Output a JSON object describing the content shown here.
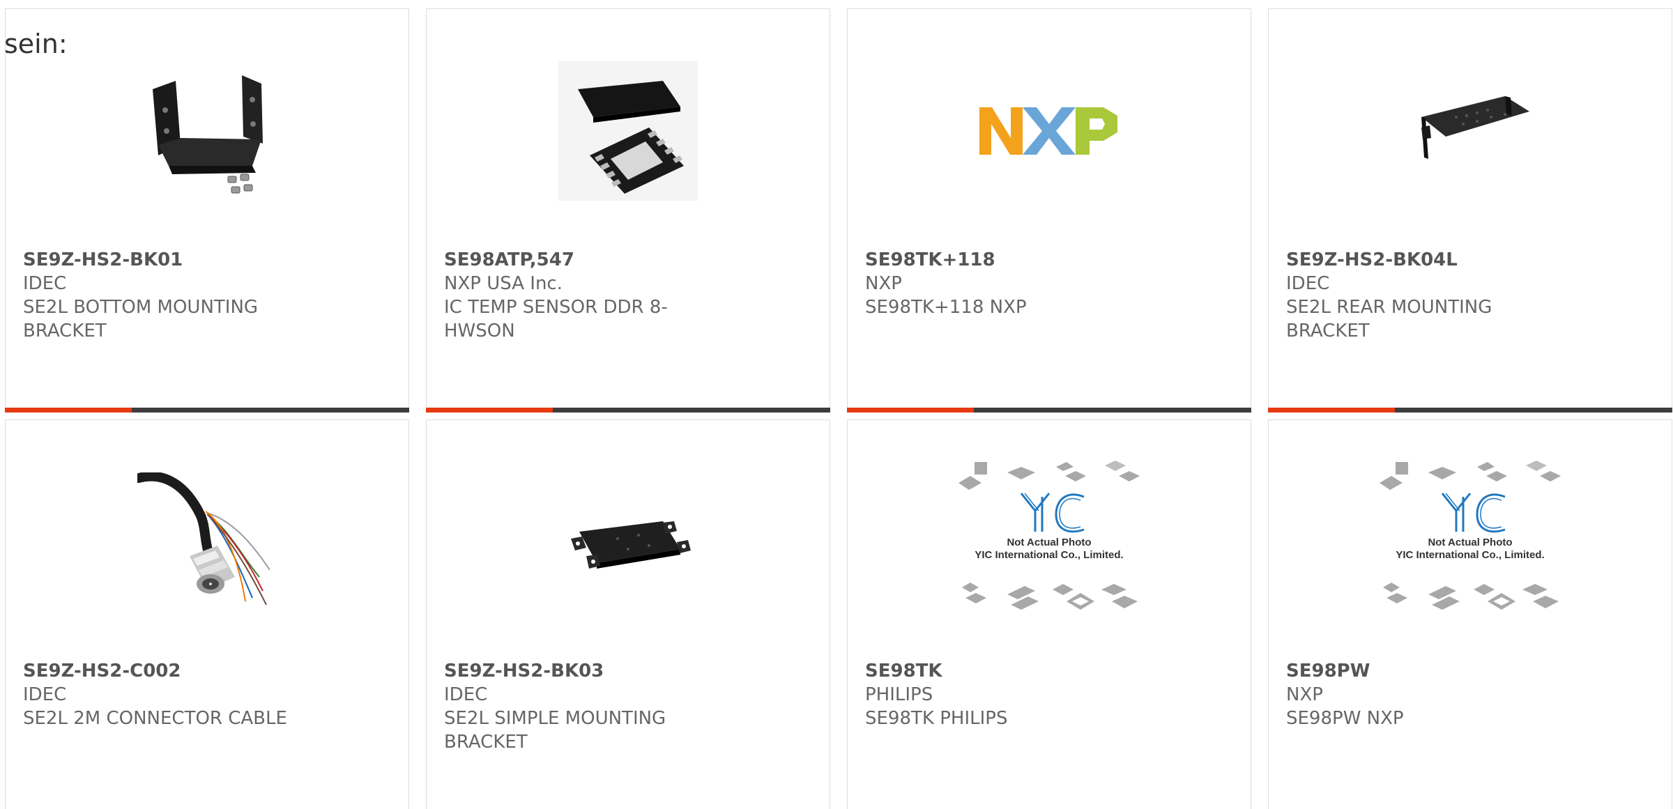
{
  "page": {
    "heading": "sein:"
  },
  "colors": {
    "accent_bar": "#e63a12",
    "dark_bar": "#3d3d3d",
    "card_border": "#dddddd",
    "text": "#666666"
  },
  "products": [
    {
      "part_number": "SE9Z-HS2-BK01",
      "manufacturer": "IDEC",
      "description": "SE2L BOTTOM MOUNTING BRACKET",
      "image": "bottom-mounting-bracket-photo",
      "show_bar": true
    },
    {
      "part_number": "SE98ATP,547",
      "manufacturer": "NXP USA Inc.",
      "description": "IC TEMP SENSOR DDR 8-HWSON",
      "image": "hwson-chip-photo",
      "show_bar": true
    },
    {
      "part_number": "SE98TK+118",
      "manufacturer": "NXP",
      "description": "SE98TK+118 NXP",
      "image": "nxp-logo",
      "show_bar": true
    },
    {
      "part_number": "SE9Z-HS2-BK04L",
      "manufacturer": "IDEC",
      "description": "SE2L REAR MOUNTING BRACKET",
      "image": "rear-mounting-bracket-photo",
      "show_bar": true
    },
    {
      "part_number": "SE9Z-HS2-C002",
      "manufacturer": "IDEC",
      "description": "SE2L 2M CONNECTOR CABLE",
      "image": "connector-cable-photo",
      "show_bar": false
    },
    {
      "part_number": "SE9Z-HS2-BK03",
      "manufacturer": "IDEC",
      "description": "SE2L SIMPLE MOUNTING BRACKET",
      "image": "simple-mounting-bracket-photo",
      "show_bar": false
    },
    {
      "part_number": "SE98TK",
      "manufacturer": "PHILIPS",
      "description": "SE98TK PHILIPS",
      "image": "yic-placeholder",
      "placeholder_lines": [
        "Not Actual Photo",
        "YIC International Co., Limited."
      ],
      "show_bar": false
    },
    {
      "part_number": "SE98PW",
      "manufacturer": "NXP",
      "description": "SE98PW NXP",
      "image": "yic-placeholder",
      "placeholder_lines": [
        "Not Actual Photo",
        "YIC International Co., Limited."
      ],
      "show_bar": false
    }
  ]
}
